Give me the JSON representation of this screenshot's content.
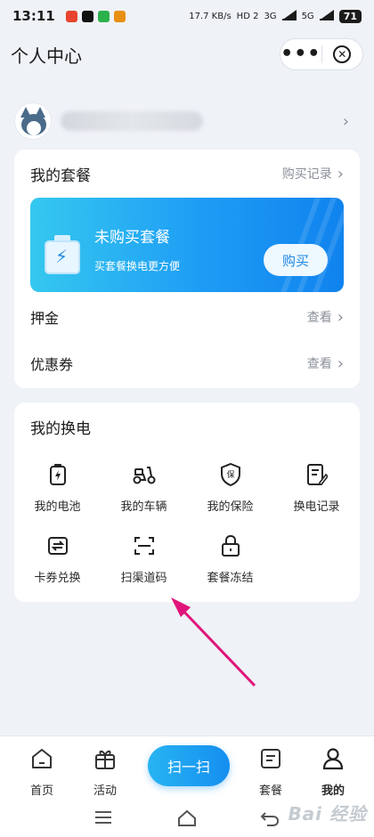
{
  "status_bar": {
    "time": "13:11",
    "app_icons": [
      "#e8442f",
      "#111111",
      "#2bb24c",
      "#e89012"
    ],
    "net_speed": "17.7 KB/s",
    "hd": "HD 2",
    "signal1": "3G",
    "signal2": "5G",
    "battery": "71"
  },
  "nav": {
    "title": "个人中心"
  },
  "user": {
    "name": ""
  },
  "package_card": {
    "title": "我的套餐",
    "link": "购买记录",
    "banner": {
      "title": "未购买套餐",
      "subtitle": "买套餐换电更方便",
      "button": "购买"
    },
    "rows": [
      {
        "label": "押金",
        "action": "查看"
      },
      {
        "label": "优惠券",
        "action": "查看"
      }
    ]
  },
  "swap_card": {
    "title": "我的换电",
    "items": [
      {
        "label": "我的电池",
        "icon": "battery-icon"
      },
      {
        "label": "我的车辆",
        "icon": "scooter-icon"
      },
      {
        "label": "我的保险",
        "icon": "insurance-shield-icon"
      },
      {
        "label": "换电记录",
        "icon": "record-icon"
      },
      {
        "label": "卡券兑换",
        "icon": "exchange-icon"
      },
      {
        "label": "扫渠道码",
        "icon": "scan-code-icon"
      },
      {
        "label": "套餐冻结",
        "icon": "lock-icon"
      }
    ]
  },
  "tab_bar": {
    "tabs": [
      {
        "label": "首页",
        "icon": "home-icon"
      },
      {
        "label": "活动",
        "icon": "gift-icon"
      },
      {
        "label": "套餐",
        "icon": "package-icon"
      },
      {
        "label": "我的",
        "icon": "user-icon"
      }
    ],
    "scan_label": "扫一扫"
  },
  "watermark": "Bai 经验",
  "colors": {
    "accent": "#1e88e5",
    "annotation_arrow": "#e0147a"
  }
}
